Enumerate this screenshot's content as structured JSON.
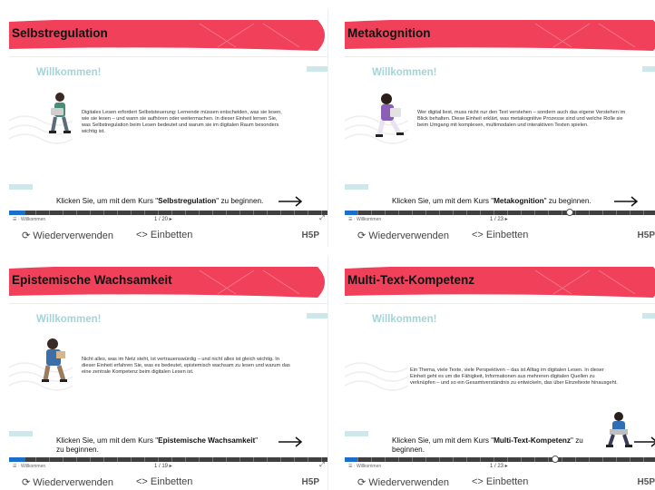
{
  "cards": [
    {
      "title": "Selbstregulation",
      "welcome": "Willkommen!",
      "description": "Digitales Lesen erfordert Selbststeuerung: Lernende müssen entscheiden, was sie lesen, wie sie lesen – und wann sie aufhören oder weitermachen. In dieser Einheit lernen Sie, was Selbstregulation beim Lesen bedeutet und warum sie im digitalen Raum besonders wichtig ist.",
      "cta_prefix": "Klicken Sie, um mit dem Kurs \"",
      "cta_course": "Selbstregulation",
      "cta_suffix": "\" zu beginnen.",
      "nav_menu": "Willkommen",
      "page": "1 / 20",
      "progress": 0.05,
      "reuse": "Wiederverwenden",
      "embed": "Einbetten",
      "logo": "H5P"
    },
    {
      "title": "Metakognition",
      "welcome": "Willkommen!",
      "description": "Wer digital liest, muss nicht nur den Text verstehen – sondern auch das eigene Verstehen im Blick behalten. Diese Einheit erklärt, was metakognitive Prozesse sind und welche Rolle sie beim Umgang mit komplexen, multimodalen und interaktiven Texten spielen.",
      "cta_prefix": "Klicken Sie, um mit dem Kurs \"",
      "cta_course": "Metakognition",
      "cta_suffix": "\" zu beginnen.",
      "nav_menu": "Willkommen",
      "page": "1 / 23",
      "progress": 0.04,
      "reuse": "Wiederverwenden",
      "embed": "Einbetten",
      "logo": "H5P"
    },
    {
      "title": "Epistemische Wachsamkeit",
      "welcome": "Willkommen!",
      "description": "Nicht alles, was im Netz steht, ist vertrauenswürdig – und nicht alles ist gleich wichtig. In dieser Einheit erfahren Sie, was es bedeutet, epistemisch wachsam zu lesen und warum das eine zentrale Kompetenz beim digitalen Lesen ist.",
      "cta_prefix": "Klicken Sie, um mit dem Kurs \"",
      "cta_course": "Epistemische Wachsamkeit",
      "cta_suffix": "\" zu beginnen.",
      "nav_menu": "Willkommen",
      "page": "1 / 19",
      "progress": 0.05,
      "reuse": "Wiederverwenden",
      "embed": "Einbetten",
      "logo": "H5P"
    },
    {
      "title": "Multi-Text-Kompetenz",
      "welcome": "Willkommen!",
      "description": "Ein Thema, viele Texte, viele Perspektiven – das ist Alltag im digitalen Lesen. In dieser Einheit geht es um die Fähigkeit, Informationen aus mehreren digitalen Quellen zu verknüpfen – und so ein Gesamtverständnis zu entwickeln, das über Einzeltexte hinausgeht.",
      "cta_prefix": "Klicken Sie, um mit dem Kurs \"",
      "cta_course": "Multi-Text-Kompetenz",
      "cta_suffix": "\" zu beginnen.",
      "nav_menu": "Willkommen",
      "page": "1 / 23",
      "progress": 0.04,
      "reuse": "Wiederverwenden",
      "embed": "Einbetten",
      "logo": "H5P"
    }
  ],
  "colors": {
    "banner": "#f0405a",
    "welcome": "#a5d3d7",
    "progress_fill": "#1b6fc9"
  },
  "icons": {
    "reuse": "refresh-icon",
    "embed": "code-icon",
    "menu": "menu-icon",
    "fullscreen": "fullscreen-icon",
    "arrow": "arrow-right-icon"
  }
}
